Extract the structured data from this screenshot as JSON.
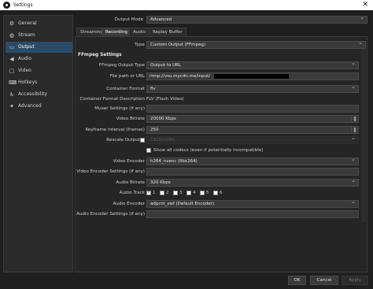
{
  "window": {
    "title": "Settings"
  },
  "sidebar": {
    "items": [
      {
        "label": "General",
        "icon": "gear-icon",
        "glyph": "⚙"
      },
      {
        "label": "Stream",
        "icon": "globe-icon",
        "glyph": "◍"
      },
      {
        "label": "Output",
        "icon": "output-icon",
        "glyph": "▭"
      },
      {
        "label": "Audio",
        "icon": "speaker-icon",
        "glyph": "◀"
      },
      {
        "label": "Video",
        "icon": "monitor-icon",
        "glyph": "▢"
      },
      {
        "label": "Hotkeys",
        "icon": "keyboard-icon",
        "glyph": "⌨"
      },
      {
        "label": "Accessibility",
        "icon": "accessibility-icon",
        "glyph": "♿"
      },
      {
        "label": "Advanced",
        "icon": "wrench-icon",
        "glyph": "✦"
      }
    ],
    "active": "Output"
  },
  "output_mode": {
    "label": "Output Mode",
    "value": "Advanced"
  },
  "tabs": [
    "Streaming",
    "Recording",
    "Audio",
    "Replay Buffer"
  ],
  "active_tab": "Recording",
  "type": {
    "label": "Type",
    "value": "Custom Output (FFmpeg)"
  },
  "section_title": "FFmpeg Settings",
  "form": {
    "ffmpeg_output_type": {
      "label": "FFmpeg Output Type",
      "value": "Output to URL"
    },
    "file_path": {
      "label": "File path or URL",
      "value": "rtmp://vsu.mycdn.me/input/"
    },
    "container_format": {
      "label": "Container Format",
      "value": "flv"
    },
    "container_format_desc": {
      "label": "Container Format Description",
      "value": "FLV (Flash Video)"
    },
    "muxer_settings": {
      "label": "Muxer Settings (if any)",
      "value": ""
    },
    "video_bitrate": {
      "label": "Video Bitrate",
      "value": "20000 Kbps"
    },
    "keyframe_interval": {
      "label": "Keyframe interval (frames)",
      "value": "250"
    },
    "rescale_output": {
      "label": "Rescale Output",
      "value": "1920x1080"
    },
    "show_all_codecs": {
      "label": "Show all codecs (even if potentially incompatible)"
    },
    "video_encoder": {
      "label": "Video Encoder",
      "value": "h264_nvenc (libx264)"
    },
    "video_encoder_settings": {
      "label": "Video Encoder Settings (if any)",
      "value": ""
    },
    "audio_bitrate": {
      "label": "Audio Bitrate",
      "value": "320 Kbps"
    },
    "audio_track": {
      "label": "Audio Track",
      "tracks": [
        "1",
        "2",
        "3",
        "4",
        "5",
        "6"
      ],
      "checked": [
        true,
        false,
        false,
        false,
        false,
        false
      ]
    },
    "audio_encoder": {
      "label": "Audio Encoder",
      "value": "adpcm_swf (Default Encoder)"
    },
    "audio_encoder_settings": {
      "label": "Audio Encoder Settings (if any)",
      "value": ""
    }
  },
  "buttons": {
    "ok": "OK",
    "cancel": "Cancel",
    "apply": "Apply"
  },
  "colors": {
    "background": "#1f1f1f",
    "selection": "#2a4b67",
    "field": "#3a3a3a"
  }
}
